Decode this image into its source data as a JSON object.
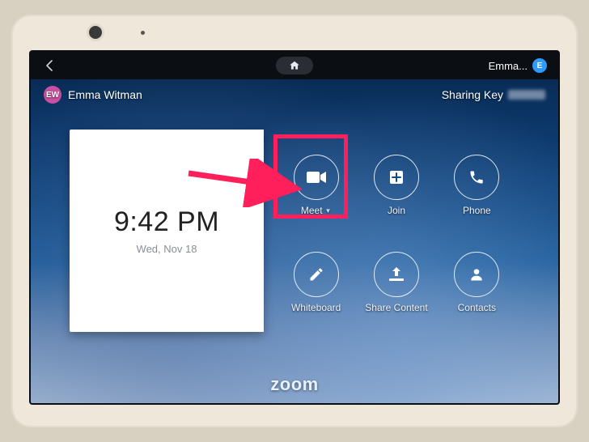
{
  "sysbar": {
    "user_short": "Emma...",
    "avatar_initial": "E"
  },
  "header": {
    "avatar_initials": "EW",
    "user_name": "Emma Witman",
    "sharing_label": "Sharing Key"
  },
  "clock": {
    "time": "9:42 PM",
    "date": "Wed, Nov 18"
  },
  "actions": [
    {
      "id": "meet",
      "label": "Meet",
      "icon": "video",
      "has_dropdown": true
    },
    {
      "id": "join",
      "label": "Join",
      "icon": "plus",
      "has_dropdown": false
    },
    {
      "id": "phone",
      "label": "Phone",
      "icon": "phone",
      "has_dropdown": false
    },
    {
      "id": "wb",
      "label": "Whiteboard",
      "icon": "pencil",
      "has_dropdown": false
    },
    {
      "id": "share",
      "label": "Share Content",
      "icon": "share",
      "has_dropdown": false
    },
    {
      "id": "cont",
      "label": "Contacts",
      "icon": "person",
      "has_dropdown": false
    }
  ],
  "branding": {
    "logo_text": "zoom"
  },
  "annotation": {
    "highlight_action_id": "meet",
    "highlight_color": "#ff1f5a"
  }
}
